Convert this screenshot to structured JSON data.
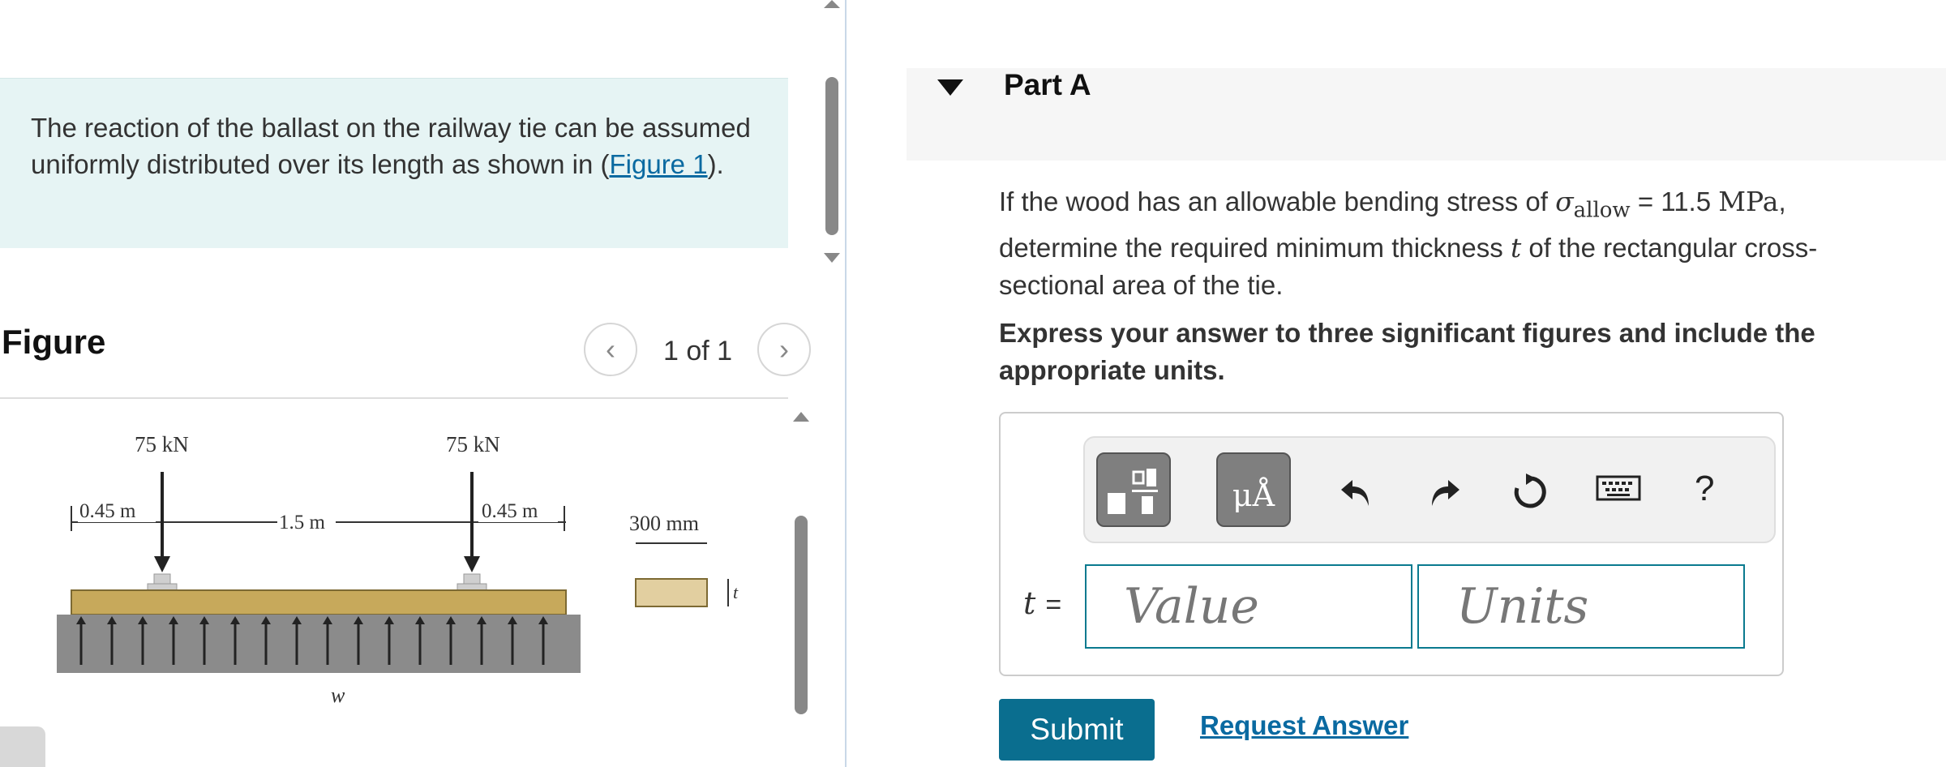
{
  "intro": {
    "text_before": "The reaction of the ballast on the railway tie can be assumed uniformly distributed over its length as shown in (",
    "figure_link": "Figure 1",
    "text_after": ")."
  },
  "figure_panel": {
    "title": "Figure",
    "counter": "1 of 1",
    "labels": {
      "load_left": "75 kN",
      "load_right": "75 kN",
      "dim_left": "0.45 m",
      "dim_middle": "1.5 m",
      "dim_right": "0.45 m",
      "width": "300 mm",
      "thickness": "t",
      "distributed": "w"
    }
  },
  "part": {
    "title": "Part A",
    "question": {
      "pre": "If the wood has an allowable bending stress of ",
      "sigma": "σ",
      "sigma_sub": "allow",
      "eq": " = 11.5 ",
      "unit": "MPa",
      "mid": ", determine the required minimum thickness ",
      "var": "t",
      "post": " of the rectangular cross-sectional area of the tie."
    },
    "instructions": "Express your answer to three significant figures and include the appropriate units.",
    "toolbar": {
      "templates_icon": "templates-icon",
      "units_icon": "units-icon",
      "units_label": "μÅ",
      "undo_icon": "undo-icon",
      "redo_icon": "redo-icon",
      "reset_icon": "reset-icon",
      "keyboard_icon": "keyboard-icon",
      "help_label": "?"
    },
    "answer": {
      "variable": "t",
      "equals": "=",
      "value_placeholder": "Value",
      "units_placeholder": "Units"
    },
    "submit_label": "Submit",
    "request_label": "Request Answer"
  },
  "colors": {
    "intro_bg": "#e6f4f4",
    "link": "#0a6aa1",
    "submit_bg": "#0a6e8f",
    "input_border": "#0a7a8f"
  }
}
